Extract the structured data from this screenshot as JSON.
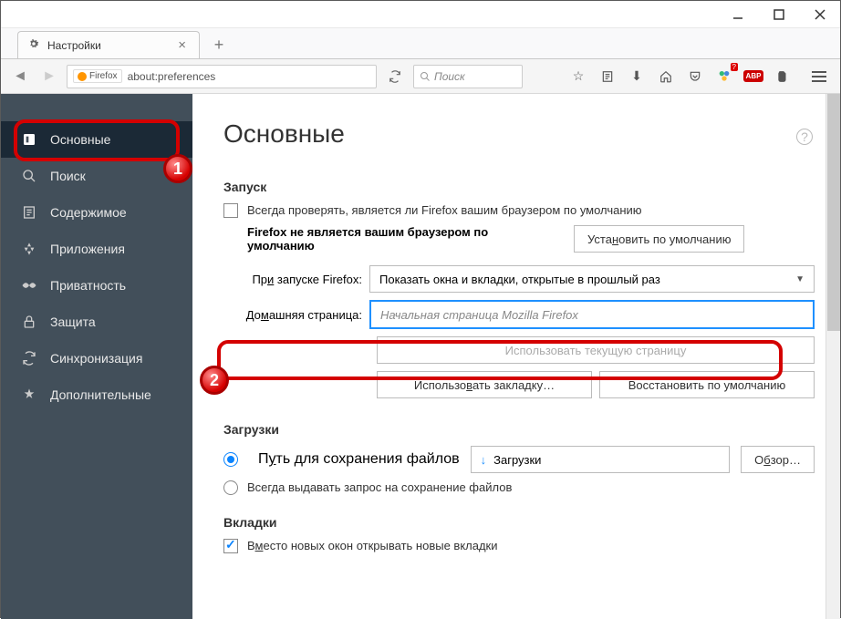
{
  "tab": {
    "title": "Настройки"
  },
  "url": {
    "scheme_label": "Firefox",
    "address": "about:preferences"
  },
  "search": {
    "placeholder": "Поиск"
  },
  "sidebar": {
    "items": [
      {
        "label": "Основные"
      },
      {
        "label": "Поиск"
      },
      {
        "label": "Содержимое"
      },
      {
        "label": "Приложения"
      },
      {
        "label": "Приватность"
      },
      {
        "label": "Защита"
      },
      {
        "label": "Синхронизация"
      },
      {
        "label": "Дополнительные"
      }
    ]
  },
  "page": {
    "title": "Основные",
    "help": "?",
    "startup": {
      "heading": "Запуск",
      "check_default_label": "Всегда проверять, является ли Firefox вашим браузером по умолчанию",
      "not_default_msg": "Firefox не является вашим браузером по умолчанию",
      "set_default_btn": "Установить по умолчанию",
      "on_start_label": "При запуске Firefox:",
      "on_start_value": "Показать окна и вкладки, открытые в прошлый раз",
      "homepage_label": "Домашняя страница:",
      "homepage_placeholder": "Начальная страница Mozilla Firefox",
      "use_current_btn": "Использовать текущую страницу",
      "use_bookmark_btn": "Использовать закладку…",
      "restore_default_btn": "Восстановить по умолчанию"
    },
    "downloads": {
      "heading": "Загрузки",
      "save_to_label": "Путь для сохранения файлов",
      "path_value": "Загрузки",
      "browse_btn": "Обзор…",
      "always_ask_label": "Всегда выдавать запрос на сохранение файлов"
    },
    "tabs": {
      "heading": "Вкладки",
      "open_in_tabs_label": "Вместо новых окон открывать новые вкладки"
    }
  },
  "annotations": {
    "badge1": "1",
    "badge2": "2"
  }
}
